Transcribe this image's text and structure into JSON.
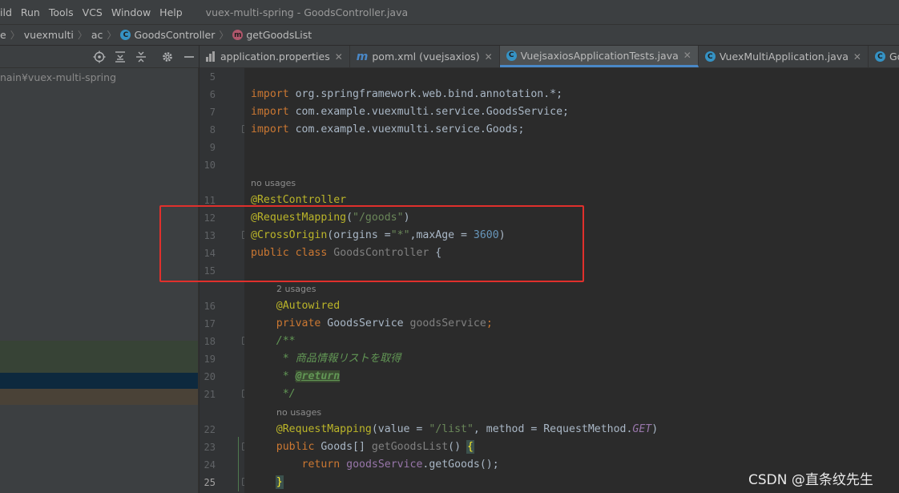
{
  "menubar": {
    "items": [
      "ild",
      "Run",
      "Tools",
      "VCS",
      "Window",
      "Help"
    ],
    "title": "vuex-multi-spring - GoodsController.java"
  },
  "breadcrumb": {
    "items": [
      "e",
      "vuexmulti",
      "ac",
      "GoodsController",
      "getGoodsList"
    ],
    "class_icon": "C",
    "method_icon": "m"
  },
  "project": {
    "path": "nain¥vuex-multi-spring"
  },
  "tabs": [
    {
      "label": "application.properties",
      "icon": "properties-icon"
    },
    {
      "label": "pom.xml (vuejsaxios)",
      "icon": "maven-icon"
    },
    {
      "label": "VuejsaxiosApplicationTests.java",
      "icon": "class-icon",
      "active": true
    },
    {
      "label": "VuexMultiApplication.java",
      "icon": "class-icon"
    },
    {
      "label": "Goods.java",
      "icon": "class-icon"
    },
    {
      "label": "G",
      "icon": "class-icon"
    }
  ],
  "code": {
    "line_numbers": [
      "5",
      "6",
      "7",
      "8",
      "9",
      "10",
      "11",
      "12",
      "13",
      "14",
      "15",
      "16",
      "17",
      "18",
      "19",
      "20",
      "21",
      "22",
      "23",
      "24",
      "25"
    ],
    "import_kw": "import",
    "import1": " org.springframework.web.bind.annotation.*;",
    "import2": " com.example.vuexmulti.service.GoodsService;",
    "import3": " com.example.vuexmulti.service.Goods;",
    "hint_no_usages": "no usages",
    "hint_2_usages": "2 usages",
    "ann_rest": "@RestController",
    "ann_req": "@RequestMapping",
    "req_path": "\"/goods\"",
    "ann_cross": "@CrossOrigin",
    "cross_args1": "(origins =",
    "cross_str": "\"*\"",
    "cross_args2": ",maxAge = ",
    "cross_num": "3600",
    "public_kw": "public",
    "class_kw": "class",
    "class_name": "GoodsController",
    "ann_autowired": "@Autowired",
    "private_kw": "private",
    "goods_service_type": "GoodsService",
    "goods_service_field": "goodsService",
    "doc_open": "/**",
    "doc_line": " * 商品情報リストを取得",
    "doc_return_prefix": " * ",
    "doc_return": "@return",
    "doc_close": " */",
    "map_value": "(value = ",
    "map_path": "\"/list\"",
    "map_method": ", method = RequestMethod.",
    "map_get": "GET",
    "goods_array": "Goods[]",
    "method_name": "getGoodsList",
    "return_kw": "return",
    "return_call": ".getGoods();",
    "close_brace": "}"
  },
  "watermark": "CSDN @直条纹先生"
}
